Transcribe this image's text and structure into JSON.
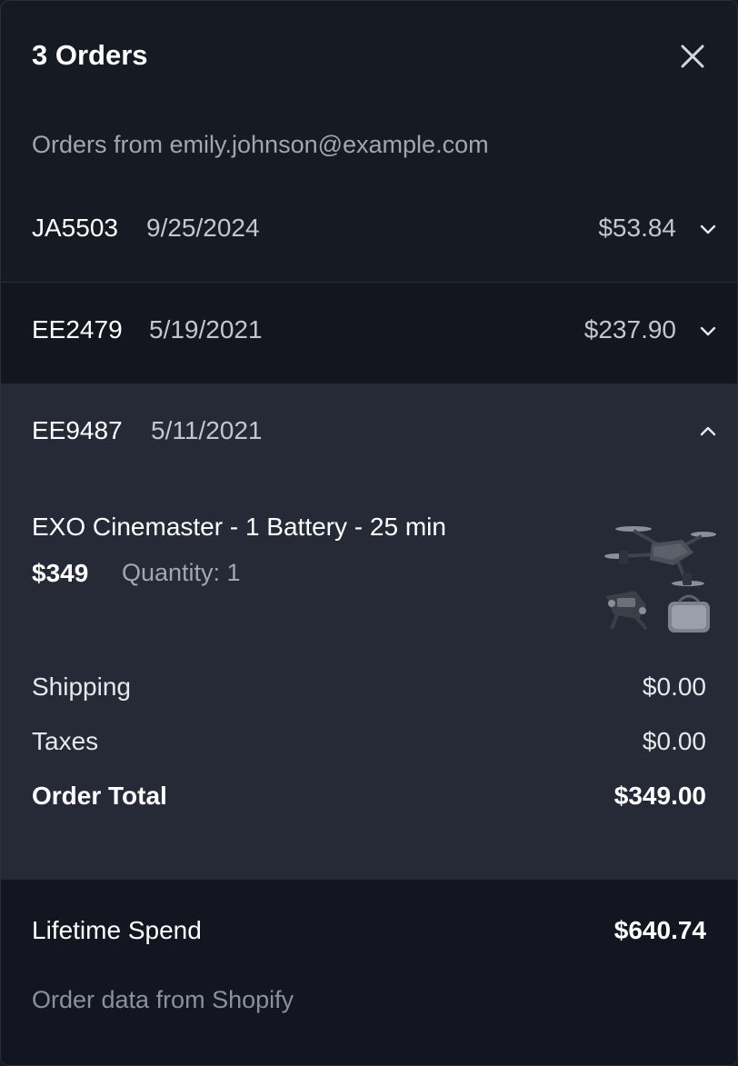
{
  "header": {
    "title": "3 Orders",
    "close_icon": "close-icon"
  },
  "subtitle": "Orders from emily.johnson@example.com",
  "orders": [
    {
      "id": "JA5503",
      "date": "9/25/2024",
      "amount": "$53.84",
      "expanded": false,
      "toggle_icon": "chevron-down-icon"
    },
    {
      "id": "EE2479",
      "date": "5/19/2021",
      "amount": "$237.90",
      "expanded": false,
      "toggle_icon": "chevron-down-icon"
    },
    {
      "id": "EE9487",
      "date": "5/11/2021",
      "expanded": true,
      "toggle_icon": "chevron-up-icon",
      "item": {
        "name": "EXO Cinemaster - 1 Battery - 25 min",
        "price": "$349",
        "quantity": "Quantity: 1",
        "image": "drone-product-image"
      },
      "summary": {
        "shipping_label": "Shipping",
        "shipping_value": "$0.00",
        "taxes_label": "Taxes",
        "taxes_value": "$0.00",
        "total_label": "Order Total",
        "total_value": "$349.00"
      }
    }
  ],
  "footer": {
    "lifetime_label": "Lifetime Spend",
    "lifetime_value": "$640.74",
    "source": "Order data from Shopify"
  },
  "colors": {
    "background": "#161a23",
    "expanded_background": "#252a36",
    "footer_background": "#131620",
    "muted_text": "#a2a6b0"
  }
}
